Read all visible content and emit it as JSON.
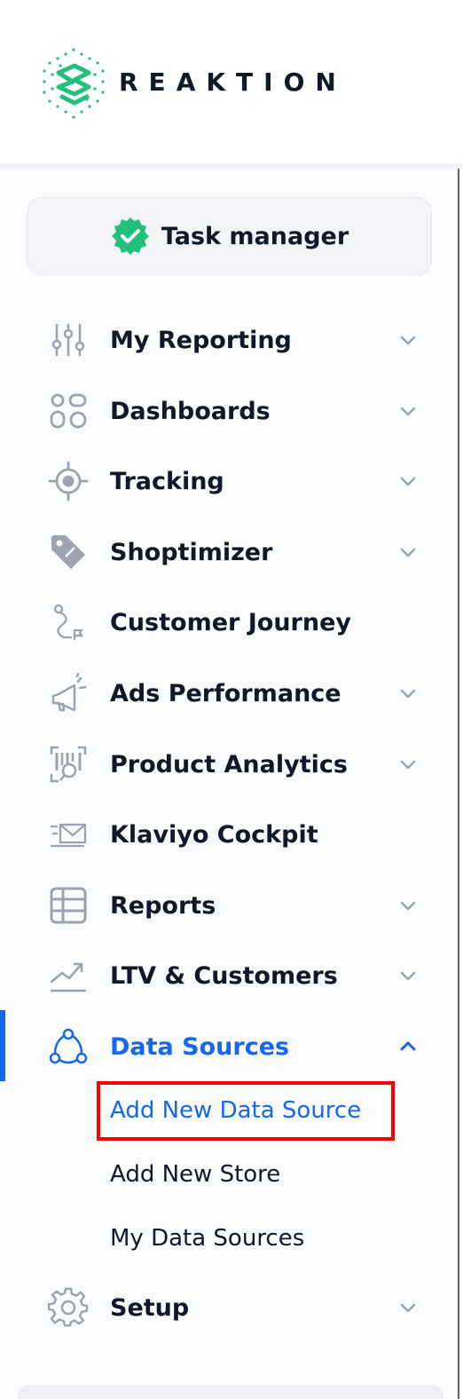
{
  "brand": {
    "name": "REAKTION"
  },
  "task_manager": {
    "label": "Task manager"
  },
  "nav": {
    "my_reporting": "My Reporting",
    "dashboards": "Dashboards",
    "tracking": "Tracking",
    "shoptimizer": "Shoptimizer",
    "customer_journey": "Customer Journey",
    "ads_performance": "Ads Performance",
    "product_analytics": "Product Analytics",
    "klaviyo_cockpit": "Klaviyo Cockpit",
    "reports": "Reports",
    "ltv_customers": "LTV & Customers",
    "data_sources": "Data Sources",
    "setup": "Setup"
  },
  "data_sources_sub": {
    "add_new_data_source": "Add New Data Source",
    "add_new_store": "Add New Store",
    "my_data_sources": "My Data Sources"
  },
  "colors": {
    "accent": "#1766f2",
    "brand_green": "#22c07a",
    "text": "#111827",
    "icon": "#9ca3af",
    "highlight": "#ff0000"
  }
}
